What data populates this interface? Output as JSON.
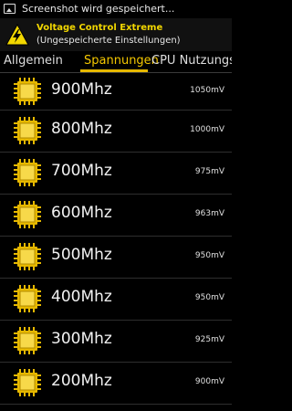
{
  "status_bar": {
    "text": "Screenshot wird gespeichert..."
  },
  "app_bar": {
    "title": "Voltage Control Extreme",
    "subtitle": "(Ungespeicherte Einstellungen)"
  },
  "tabs": [
    {
      "label": "Allgemein"
    },
    {
      "label": "Spannungen"
    },
    {
      "label": "CPU Nutzungsv"
    }
  ],
  "active_tab": "Spannungen",
  "colors": {
    "accent": "#f2d700",
    "tab_indicator": "#e6b800",
    "background": "#000000"
  },
  "voltage_rows": [
    {
      "frequency": "900Mhz",
      "voltage": "1050mV"
    },
    {
      "frequency": "800Mhz",
      "voltage": "1000mV"
    },
    {
      "frequency": "700Mhz",
      "voltage": "975mV"
    },
    {
      "frequency": "600Mhz",
      "voltage": "963mV"
    },
    {
      "frequency": "500Mhz",
      "voltage": "950mV"
    },
    {
      "frequency": "400Mhz",
      "voltage": "950mV"
    },
    {
      "frequency": "300Mhz",
      "voltage": "925mV"
    },
    {
      "frequency": "200Mhz",
      "voltage": "900mV"
    }
  ]
}
